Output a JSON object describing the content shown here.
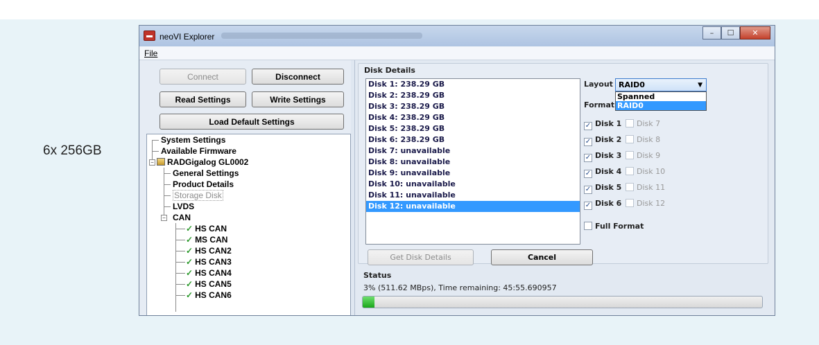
{
  "caption": "6x 256GB",
  "window": {
    "title": "neoVI Explorer",
    "minimize_icon": "minimize-icon",
    "maximize_icon": "maximize-icon",
    "close_icon": "close-icon"
  },
  "menu": {
    "file": "File"
  },
  "left": {
    "connect": "Connect",
    "disconnect": "Disconnect",
    "read_settings": "Read Settings",
    "write_settings": "Write Settings",
    "load_defaults": "Load Default Settings"
  },
  "tree": {
    "system_settings": "System Settings",
    "available_firmware": "Available Firmware",
    "device": "RADGigalog GL0002",
    "general_settings": "General Settings",
    "product_details": "Product Details",
    "storage_disk": "Storage Disk",
    "lvds": "LVDS",
    "can": "CAN",
    "can_channels": [
      "HS CAN",
      "MS CAN",
      "HS CAN2",
      "HS CAN3",
      "HS CAN4",
      "HS CAN5",
      "HS CAN6"
    ]
  },
  "disk_details": {
    "heading": "Disk Details",
    "disks": [
      "Disk 1: 238.29 GB",
      "Disk 2: 238.29 GB",
      "Disk 3: 238.29 GB",
      "Disk 4: 238.29 GB",
      "Disk 5: 238.29 GB",
      "Disk 6: 238.29 GB",
      "Disk 7: unavailable",
      "Disk 8: unavailable",
      "Disk 9: unavailable",
      "Disk 10: unavailable",
      "Disk 11: unavailable",
      "Disk 12: unavailable"
    ],
    "selected_index": 11,
    "layout_label": "Layout",
    "layout_value": "RAID0",
    "layout_options": [
      "Spanned",
      "RAID0"
    ],
    "format_label": "Format",
    "checkboxes": [
      {
        "label": "Disk 1",
        "checked": true
      },
      {
        "label": "Disk 7",
        "checked": false
      },
      {
        "label": "Disk 2",
        "checked": true
      },
      {
        "label": "Disk 8",
        "checked": false
      },
      {
        "label": "Disk 3",
        "checked": true
      },
      {
        "label": "Disk 9",
        "checked": false
      },
      {
        "label": "Disk 4",
        "checked": true
      },
      {
        "label": "Disk 10",
        "checked": false
      },
      {
        "label": "Disk 5",
        "checked": true
      },
      {
        "label": "Disk 11",
        "checked": false
      },
      {
        "label": "Disk 6",
        "checked": true
      },
      {
        "label": "Disk 12",
        "checked": false
      }
    ],
    "full_format": "Full Format",
    "get_disk_details": "Get Disk Details",
    "cancel": "Cancel"
  },
  "status": {
    "heading": "Status",
    "text": "3% (511.62 MBps), Time remaining: 45:55.690957",
    "progress_fraction": 0.03
  },
  "colors": {
    "selection": "#3399ff",
    "progress": "#1aa61a",
    "check": "#2c9a2c"
  }
}
